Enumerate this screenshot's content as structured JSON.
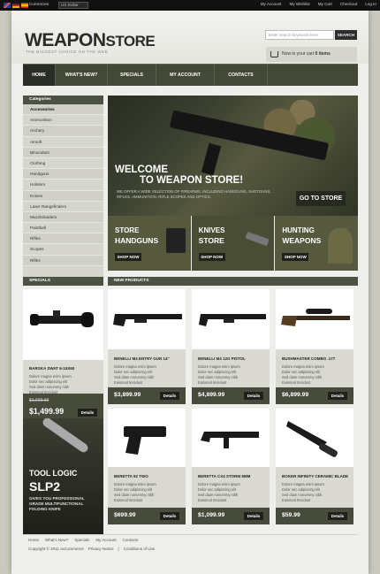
{
  "topbar": {
    "currency_label": "Currencies",
    "currency_selected": "US Dollar",
    "links": [
      "My Account",
      "My Wishlist",
      "My Cart",
      "Checkout",
      "Log In"
    ]
  },
  "header": {
    "logo_main": "WEAPON",
    "logo_tail": "STORE",
    "tagline": "THE BIGGEST CHOICE ON THE WEB",
    "search_placeholder": "Enter search keywords here",
    "search_button": "SEARCH",
    "cart_text": "Now in your cart",
    "cart_count": "0 items"
  },
  "nav": [
    "HOME",
    "WHAT'S NEW?",
    "SPECIALS",
    "MY ACCOUNT",
    "CONTACTS"
  ],
  "categories": {
    "title": "Categories",
    "items": [
      "Accessories",
      "Ammunition",
      "Archery",
      "Airsoft",
      "Binoculars",
      "Clothing",
      "Handguns",
      "Holsters",
      "Knives",
      "Laser Rangefinders",
      "Muzzleloaders",
      "Paintball",
      "Rifles",
      "Scopes",
      "Rifles"
    ]
  },
  "banner": {
    "welcome_1": "WELCOME",
    "welcome_2": "TO WEAPON STORE!",
    "sub": "WE OFFER A WIDE SELECTION OF FIREARMS, INCLUDING HANDGUNS, SHOTGUNS, RIFLES, AMMUNITION, RIFLE SCOPES AND OPTICS.",
    "go_label": "GO TO STORE"
  },
  "promos": [
    {
      "t1": "STORE",
      "t2": "HANDGUNS",
      "shop": "SHOP NOW"
    },
    {
      "t1": "KNIVES",
      "t2": "STORE",
      "shop": "SHOP NOW"
    },
    {
      "t1": "HUNTING",
      "t2": "WEAPONS",
      "shop": "SHOP NOW"
    }
  ],
  "sections": {
    "specials": "SPECIALS",
    "new_products": "NEW PRODUCTS"
  },
  "special": {
    "name": "BARSKA SWAT 6-24X60",
    "bullets": [
      "Dolore magna enim ipsum",
      "Dolor sec adipiscing elit",
      "Sed diam nonummy nibh",
      "Euismod tincidunt"
    ],
    "old_price": "$1,699.99",
    "price": "$1,499.99",
    "details": "Details"
  },
  "products": [
    {
      "name": "BENELLI M4 ENTRY GUN 14\"",
      "bullets": [
        "Dolore magna enim ipsum",
        "Dolor sec adipiscing elit",
        "Sed diam nonummy nibh",
        "Euismod tincidunt"
      ],
      "price": "$3,899.99",
      "details": "Details"
    },
    {
      "name": "BENELLI M4 12G PISTOL",
      "bullets": [
        "Dolore magna enim ipsum",
        "Dolor sec adipiscing elit",
        "Sed diam nonummy nibh",
        "Euismod tincidunt"
      ],
      "price": "$4,899.99",
      "details": "Details"
    },
    {
      "name": "BUSHMASTER COMBO .177",
      "bullets": [
        "Dolore magna enim ipsum",
        "Dolor sec adipiscing elit",
        "Sed diam nonummy nibh",
        "Euismod tincidunt"
      ],
      "price": "$6,899.99",
      "details": "Details"
    },
    {
      "name": "BERETTA 92 TWO",
      "bullets": [
        "Dolore magna enim ipsum",
        "Dolor sec adipiscing elit",
        "Sed diam nonummy nibh",
        "Euismod tincidunt"
      ],
      "price": "$699.99",
      "details": "Details"
    },
    {
      "name": "BERETTA CX4 STORM 9MM",
      "bullets": [
        "Dolore magna enim ipsum",
        "Dolor sec adipiscing elit",
        "Sed diam nonummy nibh",
        "Euismod tincidunt"
      ],
      "price": "$1,099.99",
      "details": "Details"
    },
    {
      "name": "BOKER INFINITY CERAMIC BLADE",
      "bullets": [
        "Dolore magna enim ipsum",
        "Dolor sec adipiscing elit",
        "Sed diam nonummy nibh",
        "Euismod tincidunt"
      ],
      "price": "$59.99",
      "details": "Details"
    }
  ],
  "promo_ad": {
    "t1": "TOOL LOGIC",
    "t2": "SLP2",
    "t3": "GIVES YOU PROFESSIONAL GRADE MULTIFUNCTIONAL FOLDING KNIFE"
  },
  "footer": {
    "links": [
      "Home",
      "What's New?",
      "Specials",
      "My Account",
      "Contacts"
    ],
    "copyright": "Copyright © 2011 osCommerce",
    "privacy": "Privacy Notice",
    "conditions": "Conditions of Use"
  }
}
